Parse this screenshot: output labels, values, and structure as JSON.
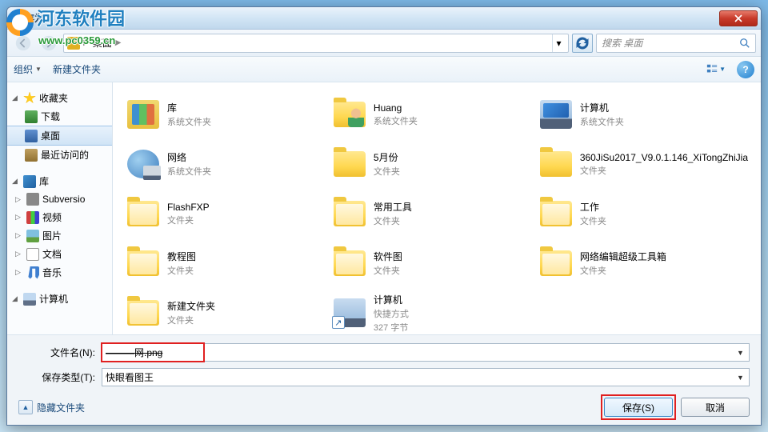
{
  "window": {
    "title": "另存为"
  },
  "watermark": {
    "title": "河东软件园",
    "url": "www.pc0359.cn"
  },
  "nav": {
    "breadcrumb_item": "桌面",
    "search_placeholder": "搜索 桌面"
  },
  "toolbar": {
    "organize": "组织",
    "new_folder": "新建文件夹",
    "help": "?"
  },
  "sidebar": {
    "favorites": {
      "label": "收藏夹",
      "items": [
        {
          "label": "下载",
          "icon": "ic-dl"
        },
        {
          "label": "桌面",
          "icon": "ic-desk",
          "selected": true
        },
        {
          "label": "最近访问的",
          "icon": "ic-recent"
        }
      ]
    },
    "libraries": {
      "label": "库",
      "items": [
        {
          "label": "Subversio",
          "icon": "ic-svn",
          "expandable": true
        },
        {
          "label": "视频",
          "icon": "ic-vid",
          "expandable": true
        },
        {
          "label": "图片",
          "icon": "ic-pic",
          "expandable": true
        },
        {
          "label": "文档",
          "icon": "ic-doc",
          "expandable": true
        },
        {
          "label": "音乐",
          "icon": "ic-mus",
          "expandable": true
        }
      ]
    },
    "computer": {
      "label": "计算机"
    }
  },
  "items": [
    {
      "name": "库",
      "sub": "系统文件夹",
      "type": "lib"
    },
    {
      "name": "Huang",
      "sub": "系统文件夹",
      "type": "user"
    },
    {
      "name": "计算机",
      "sub": "系统文件夹",
      "type": "comp"
    },
    {
      "name": "网络",
      "sub": "系统文件夹",
      "type": "net"
    },
    {
      "name": "5月份",
      "sub": "文件夹",
      "type": "folder"
    },
    {
      "name": "360JiSu2017_V9.0.1.146_XiTongZhiJia",
      "sub": "文件夹",
      "type": "folder"
    },
    {
      "name": "FlashFXP",
      "sub": "文件夹",
      "type": "folder-open"
    },
    {
      "name": "常用工具",
      "sub": "文件夹",
      "type": "folder-open"
    },
    {
      "name": "工作",
      "sub": "文件夹",
      "type": "folder-open"
    },
    {
      "name": "教程图",
      "sub": "文件夹",
      "type": "folder-open"
    },
    {
      "name": "软件图",
      "sub": "文件夹",
      "type": "folder-open"
    },
    {
      "name": "网络编辑超级工具箱",
      "sub": "文件夹",
      "type": "folder-open"
    },
    {
      "name": "新建文件夹",
      "sub": "文件夹",
      "type": "folder-open"
    },
    {
      "name": "计算机",
      "sub": "快捷方式",
      "sub2": "327 字节",
      "type": "shortcut"
    }
  ],
  "fields": {
    "filename_label": "文件名(N):",
    "filename_value": "———网.png",
    "filetype_label": "保存类型(T):",
    "filetype_value": "快眼看图王"
  },
  "actions": {
    "hide_folders": "隐藏文件夹",
    "save": "保存(S)",
    "cancel": "取消"
  }
}
